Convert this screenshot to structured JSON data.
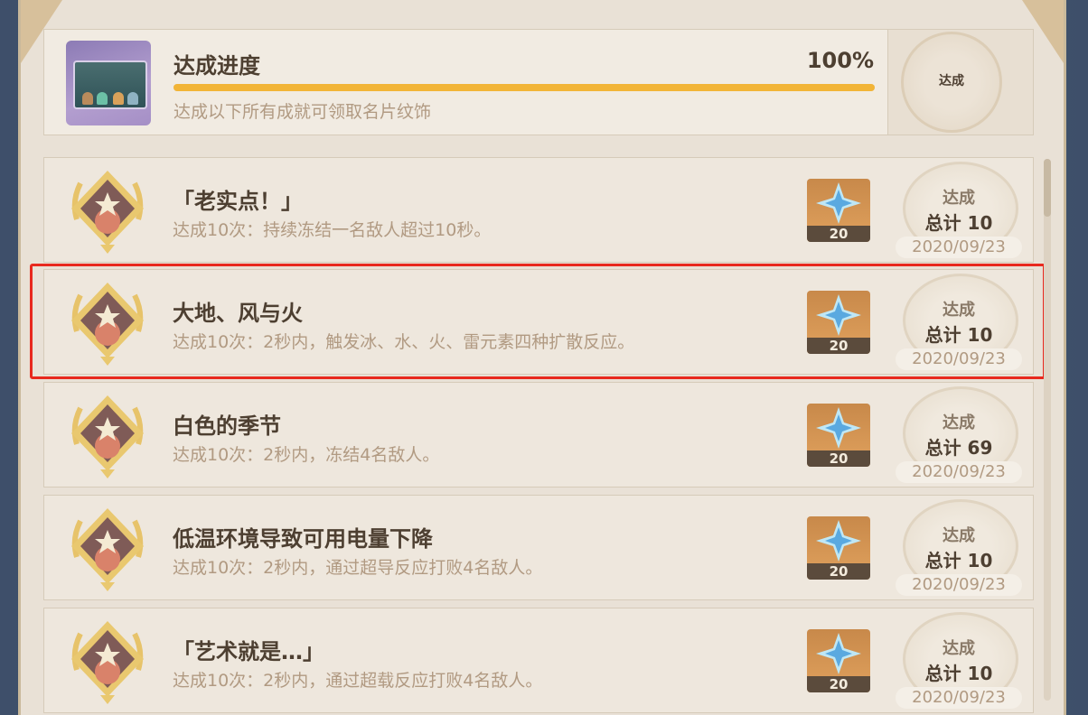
{
  "progress": {
    "title": "达成进度",
    "percent_label": "100%",
    "percent": 100,
    "description": "达成以下所有成就可领取名片纹饰",
    "stamp": "达成"
  },
  "achievements": [
    {
      "title": "「老实点！」",
      "description": "达成10次：持续冻结一名敌人超过10秒。",
      "reward": "20",
      "status": "达成",
      "total": "总计 10",
      "date": "2020/09/23"
    },
    {
      "title": "大地、风与火",
      "description": "达成10次：2秒内，触发冰、水、火、雷元素四种扩散反应。",
      "reward": "20",
      "status": "达成",
      "total": "总计 10",
      "date": "2020/09/23"
    },
    {
      "title": "白色的季节",
      "description": "达成10次：2秒内，冻结4名敌人。",
      "reward": "20",
      "status": "达成",
      "total": "总计 69",
      "date": "2020/09/23"
    },
    {
      "title": "低温环境导致可用电量下降",
      "description": "达成10次：2秒内，通过超导反应打败4名敌人。",
      "reward": "20",
      "status": "达成",
      "total": "总计 10",
      "date": "2020/09/23"
    },
    {
      "title": "「艺术就是…」",
      "description": "达成10次：2秒内，通过超载反应打败4名敌人。",
      "reward": "20",
      "status": "达成",
      "total": "总计 10",
      "date": "2020/09/23"
    }
  ],
  "colors": {
    "accent": "#f2b437",
    "highlight": "#e8291e"
  }
}
